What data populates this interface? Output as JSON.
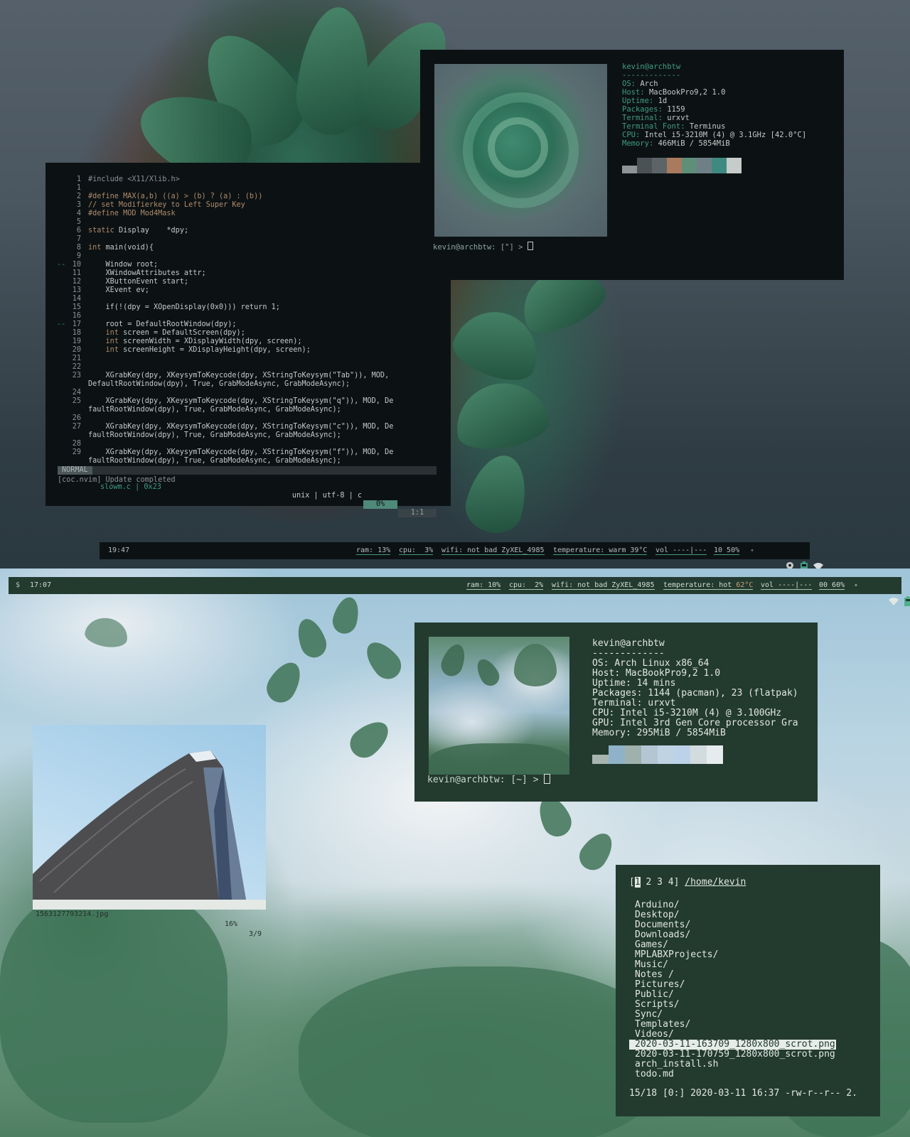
{
  "vim": {
    "lines": [
      {
        "n": "1",
        "code": "#include <X11/Xlib.h>"
      },
      {
        "n": "1",
        "code": ""
      },
      {
        "n": "2",
        "code": "#define MAX(a,b) ((a) > (b) ? (a) : (b))"
      },
      {
        "n": "3",
        "code": "// set Modifierkey to Left Super Key"
      },
      {
        "n": "4",
        "code": "#define MOD Mod4Mask"
      },
      {
        "n": "5",
        "code": ""
      },
      {
        "n": "6",
        "code": "static Display    *dpy;"
      },
      {
        "n": "7",
        "code": ""
      },
      {
        "n": "8",
        "code": "int main(void){"
      },
      {
        "n": "9",
        "code": ""
      },
      {
        "n": "10",
        "code": "    Window root;",
        "mark": "--"
      },
      {
        "n": "11",
        "code": "    XWindowAttributes attr;"
      },
      {
        "n": "12",
        "code": "    XButtonEvent start;"
      },
      {
        "n": "13",
        "code": "    XEvent ev;"
      },
      {
        "n": "14",
        "code": ""
      },
      {
        "n": "15",
        "code": "    if(!(dpy = XOpenDisplay(0x0))) return 1;"
      },
      {
        "n": "16",
        "code": ""
      },
      {
        "n": "17",
        "code": "    root = DefaultRootWindow(dpy);",
        "mark": "--"
      },
      {
        "n": "18",
        "code": "    int screen = DefaultScreen(dpy);"
      },
      {
        "n": "19",
        "code": "    int screenWidth = XDisplayWidth(dpy, screen);"
      },
      {
        "n": "20",
        "code": "    int screenHeight = XDisplayHeight(dpy, screen);"
      },
      {
        "n": "21",
        "code": ""
      },
      {
        "n": "22",
        "code": ""
      },
      {
        "n": "23",
        "code": "    XGrabKey(dpy, XKeysymToKeycode(dpy, XStringToKeysym(\"Tab\")), MOD,"
      },
      {
        "n": "",
        "code": "DefaultRootWindow(dpy), True, GrabModeAsync, GrabModeAsync);"
      },
      {
        "n": "24",
        "code": ""
      },
      {
        "n": "25",
        "code": "    XGrabKey(dpy, XKeysymToKeycode(dpy, XStringToKeysym(\"q\")), MOD, De"
      },
      {
        "n": "",
        "code": "faultRootWindow(dpy), True, GrabModeAsync, GrabModeAsync);"
      },
      {
        "n": "26",
        "code": ""
      },
      {
        "n": "27",
        "code": "    XGrabKey(dpy, XKeysymToKeycode(dpy, XStringToKeysym(\"c\")), MOD, De"
      },
      {
        "n": "",
        "code": "faultRootWindow(dpy), True, GrabModeAsync, GrabModeAsync);"
      },
      {
        "n": "28",
        "code": ""
      },
      {
        "n": "29",
        "code": "    XGrabKey(dpy, XKeysymToKeycode(dpy, XStringToKeysym(\"f\")), MOD, De"
      },
      {
        "n": "",
        "code": "faultRootWindow(dpy), True, GrabModeAsync, GrabModeAsync);"
      }
    ],
    "status": {
      "mode": "NORMAL",
      "file": "slowm.c | 0x23",
      "enc": "unix | utf-8 | c",
      "pct": "0%",
      "pos": "1:1"
    },
    "message": "[coc.nvim] Update completed"
  },
  "neofetch1": {
    "title": "kevin@archbtw",
    "rule": "-------------",
    "fields": [
      {
        "k": "OS",
        "v": "Arch"
      },
      {
        "k": "Host",
        "v": "MacBookPro9,2 1.0"
      },
      {
        "k": "Uptime",
        "v": "1d"
      },
      {
        "k": "Packages",
        "v": "1159"
      },
      {
        "k": "Terminal",
        "v": "urxvt"
      },
      {
        "k": "Terminal Font",
        "v": "Terminus"
      },
      {
        "k": "CPU",
        "v": "Intel i5-3210M (4) @ 3.1GHz [42.0°C]"
      },
      {
        "k": "Memory",
        "v": "466MiB / 5854MiB"
      }
    ],
    "swatches": [
      "#8d9396",
      "#4a5256",
      "#5c6468",
      "#a97a5e",
      "#5f8f79",
      "#6f7f86",
      "#3f8a80",
      "#c7cbc9"
    ],
    "prompt": "kevin@archbtw: [\"] > "
  },
  "bar1": {
    "time": "19:47",
    "ram": "ram: 13%",
    "cpu": "cpu:  3%",
    "wifi": "wifi: not bad ZyXEL_4985",
    "temp": "temperature: warm 39°C",
    "vol": "vol ----|---",
    "bright": "10 50%"
  },
  "bar2": {
    "ws": "$",
    "time": "17:07",
    "ram": "ram: 10%",
    "cpu": "cpu:  2%",
    "wifi": "wifi: not bad ZyXEL_4985",
    "temp_label": "temperature: hot ",
    "temp_val": "62°C",
    "vol": "vol ----|---",
    "bright": "00 60%"
  },
  "neofetch2": {
    "title": "kevin@archbtw",
    "rule": "-------------",
    "fields": [
      {
        "k": "OS",
        "v": "Arch Linux x86_64"
      },
      {
        "k": "Host",
        "v": "MacBookPro9,2 1.0"
      },
      {
        "k": "Uptime",
        "v": "14 mins"
      },
      {
        "k": "Packages",
        "v": "1144 (pacman), 23 (flatpak)"
      },
      {
        "k": "Terminal",
        "v": "urxvt"
      },
      {
        "k": "CPU",
        "v": "Intel i5-3210M (4) @ 3.100GHz"
      },
      {
        "k": "GPU",
        "v": "Intel 3rd Gen Core processor Gra"
      },
      {
        "k": "Memory",
        "v": "295MiB / 5854MiB"
      }
    ],
    "swatches": [
      "#a8b4b0",
      "#8fb2c8",
      "#9fb1ad",
      "#b3c6d2",
      "#c0d3e3",
      "#bcd2e8",
      "#d2dcdf",
      "#e6ecee"
    ],
    "prompt": "kevin@archbtw: [~] > "
  },
  "sxiv": {
    "filename": "1563127793214.jpg",
    "zoom": "16%",
    "index": "3/9"
  },
  "ranger": {
    "tabs_open": "[",
    "tab_active": "1",
    "tabs_rest": " 2 3 4]",
    "path": "/home/kevin",
    "entries": [
      "Arduino/",
      "Desktop/",
      "Documents/",
      "Downloads/",
      "Games/",
      "MPLABXProjects/",
      "Music/",
      "Notes /",
      "Pictures/",
      "Public/",
      "Scripts/",
      "Sync/",
      "Templates/",
      "Videos/",
      "2020-03-11-163709_1280x800_scrot.png",
      "2020-03-11-170759_1280x800_scrot.png",
      "arch_install.sh",
      "todo.md"
    ],
    "selected_index": 14,
    "status": "15/18 [0:] 2020-03-11 16:37 -rw-r--r-- 2."
  }
}
